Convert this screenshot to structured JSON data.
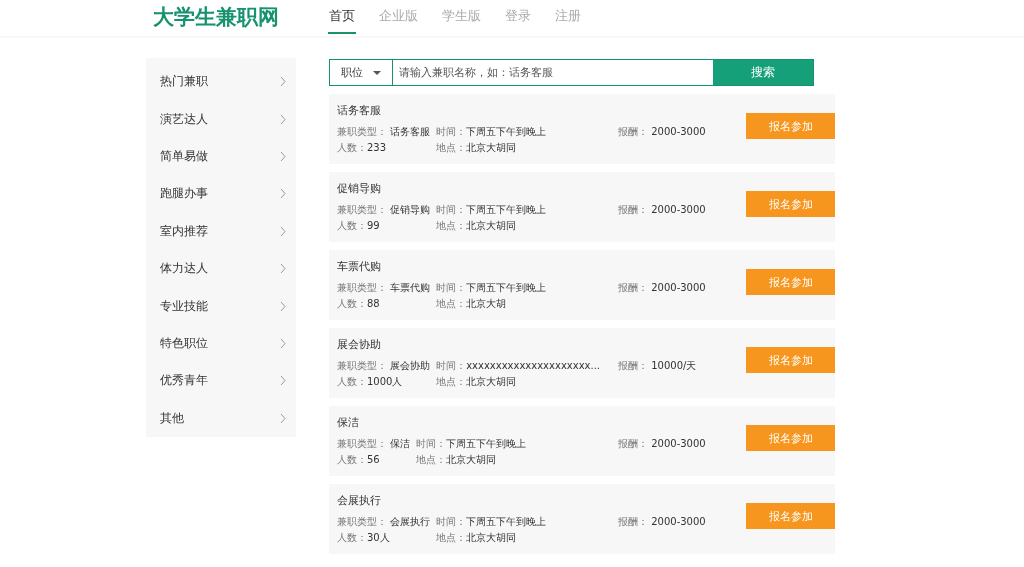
{
  "header": {
    "logo": "大学生兼职网",
    "nav": [
      {
        "label": "首页",
        "selected": true
      },
      {
        "label": "企业版",
        "selected": false
      },
      {
        "label": "学生版",
        "selected": false
      },
      {
        "label": "登录",
        "selected": false
      },
      {
        "label": "注册",
        "selected": false
      }
    ]
  },
  "sidebar": {
    "items": [
      {
        "label": "热门兼职"
      },
      {
        "label": "演艺达人"
      },
      {
        "label": "简单易做"
      },
      {
        "label": "跑腿办事"
      },
      {
        "label": "室内推荐"
      },
      {
        "label": "体力达人"
      },
      {
        "label": "专业技能"
      },
      {
        "label": "特色职位"
      },
      {
        "label": "优秀青年"
      },
      {
        "label": "其他"
      }
    ]
  },
  "search": {
    "category": "职位",
    "placeholder": "请输入兼职名称，如：话务客服",
    "button": "搜索"
  },
  "jobs": [
    {
      "title": "话务客服",
      "type_label": "兼职类型：",
      "type": "话务客服",
      "time_label": "时间：",
      "time": "下周五下午到晚上",
      "pay_label": "报酬：",
      "pay": "2000-3000",
      "count_label": "人数：",
      "count": "233",
      "place_label": "地点：",
      "place": "北京大胡同",
      "button": "报名参加"
    },
    {
      "title": "促销导购",
      "type_label": "兼职类型：",
      "type": "促销导购",
      "time_label": "时间：",
      "time": "下周五下午到晚上",
      "pay_label": "报酬：",
      "pay": "2000-3000",
      "count_label": "人数：",
      "count": "99",
      "place_label": "地点：",
      "place": "北京大胡同",
      "button": "报名参加"
    },
    {
      "title": "车票代购",
      "type_label": "兼职类型：",
      "type": "车票代购",
      "time_label": "时间：",
      "time": "下周五下午到晚上",
      "pay_label": "报酬：",
      "pay": "2000-3000",
      "count_label": "人数：",
      "count": "88",
      "place_label": "地点：",
      "place": "北京大胡",
      "button": "报名参加"
    },
    {
      "title": "展会协助",
      "type_label": "兼职类型：",
      "type": "展会协助",
      "time_label": "时间：",
      "time": "xxxxxxxxxxxxxxxxxxxxx...",
      "pay_label": "报酬：",
      "pay": "10000/天",
      "count_label": "人数：",
      "count": "1000人",
      "place_label": "地点：",
      "place": "北京大胡同",
      "button": "报名参加"
    },
    {
      "title": "保洁",
      "type_label": "兼职类型：",
      "type": "保洁",
      "time_label": "时间：",
      "time": "下周五下午到晚上",
      "pay_label": "报酬：",
      "pay": "2000-3000",
      "count_label": "人数：",
      "count": "56",
      "place_label": "地点：",
      "place": "北京大胡同",
      "button": "报名参加"
    },
    {
      "title": "会展执行",
      "type_label": "兼职类型：",
      "type": "会展执行",
      "time_label": "时间：",
      "time": "下周五下午到晚上",
      "pay_label": "报酬：",
      "pay": "2000-3000",
      "count_label": "人数：",
      "count": "30人",
      "place_label": "地点：",
      "place": "北京大胡同",
      "button": "报名参加"
    }
  ]
}
